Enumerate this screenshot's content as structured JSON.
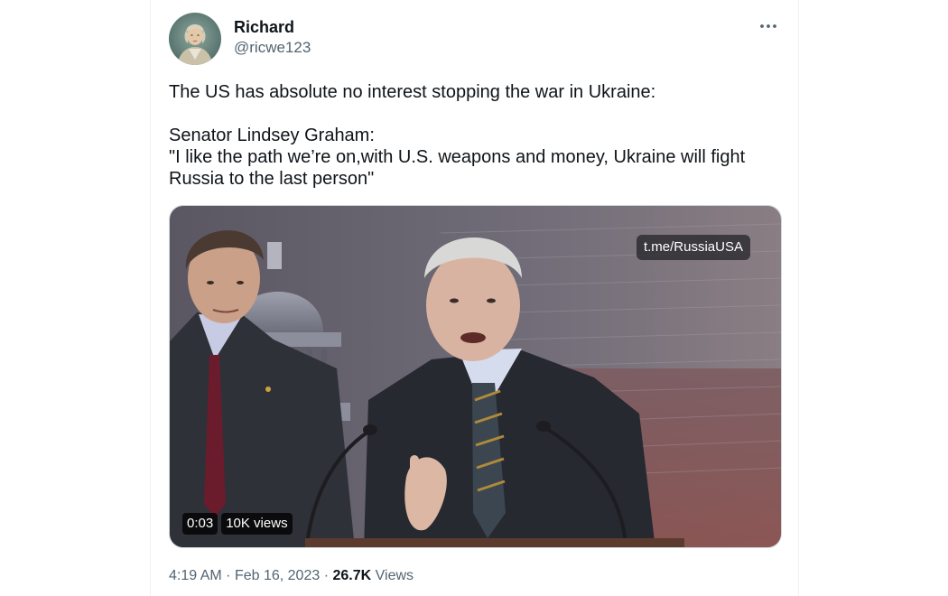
{
  "author": {
    "display_name": "Richard",
    "handle": "@ricwe123"
  },
  "menu_icon": "more-horizontal-icon",
  "tweet": {
    "lines": [
      "The US has absolute no interest stopping the war in Ukraine:",
      "Senator Lindsey Graham:",
      "\"I like the path we’re on,with U.S. weapons and money, Ukraine will fight",
      "Russia to the last person\""
    ]
  },
  "media": {
    "watermark": "t.me/RussiaUSA",
    "duration": "0:03",
    "views": "10K views"
  },
  "meta": {
    "time": "4:19 AM",
    "separator": "·",
    "date": "Feb 16, 2023",
    "views_count": "26.7K",
    "views_label": "Views"
  },
  "colors": {
    "text_primary": "#0f1419",
    "text_secondary": "#536471",
    "border": "#eff3f4"
  }
}
